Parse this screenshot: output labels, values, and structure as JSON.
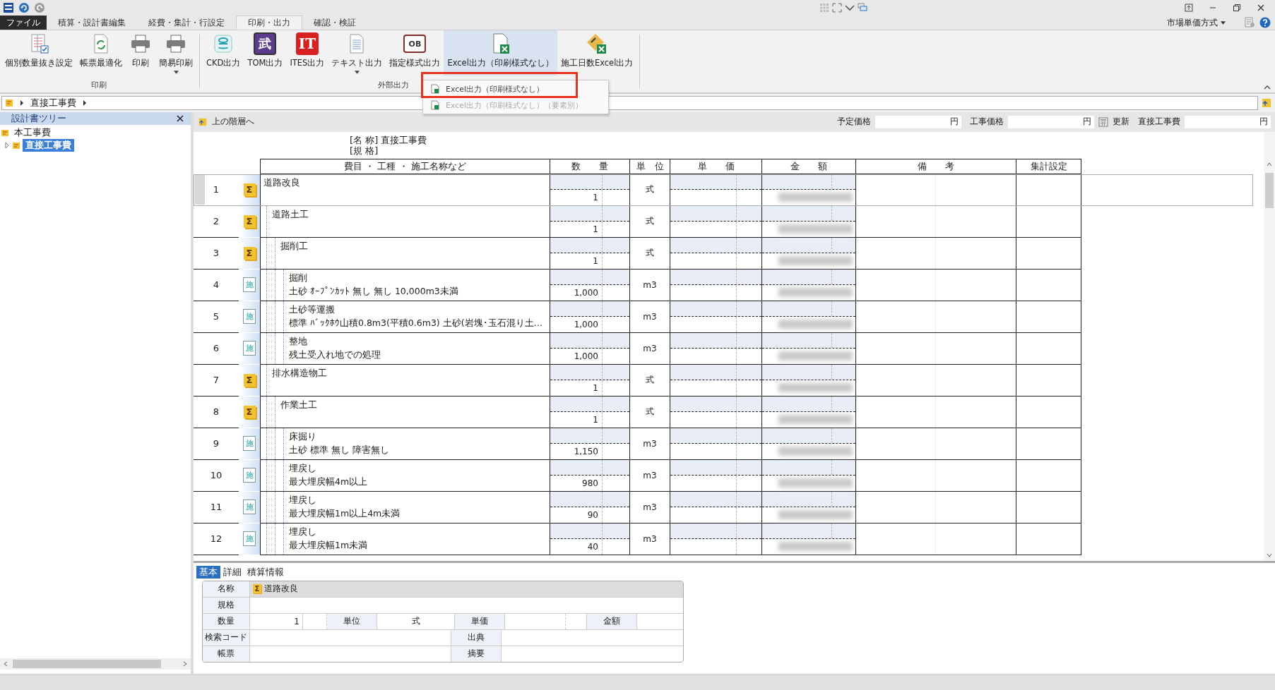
{
  "ribbon_tabs": [
    {
      "label": "ファイル",
      "kind": "file",
      "selected": false
    },
    {
      "label": "積算・設計書編集",
      "kind": "tab",
      "selected": false
    },
    {
      "label": "経費・集計・行設定",
      "kind": "tab",
      "selected": false
    },
    {
      "label": "印刷・出力",
      "kind": "tab",
      "selected": true
    },
    {
      "label": "確認・検証",
      "kind": "tab",
      "selected": false
    }
  ],
  "mode_menu": {
    "label": "市場単価方式"
  },
  "ribbon_groups": [
    {
      "label": "印刷",
      "buttons": [
        {
          "label": "個別数量抜き設定",
          "kind": "sheet-check",
          "pressed": false,
          "has_menu": false
        },
        {
          "label": "帳票最適化",
          "kind": "refresh-doc",
          "pressed": false,
          "has_menu": false
        },
        {
          "label": "印刷",
          "kind": "printer",
          "pressed": false,
          "has_menu": false
        },
        {
          "label": "簡易印刷",
          "kind": "printer",
          "pressed": false,
          "has_menu": true
        }
      ]
    },
    {
      "label": "外部出力",
      "buttons": [
        {
          "label": "CKD出力",
          "kind": "ckd",
          "pressed": false,
          "has_menu": false
        },
        {
          "label": "TOM出力",
          "kind": "tom",
          "icon_text": "武",
          "pressed": false,
          "has_menu": false
        },
        {
          "label": "ITES出力",
          "kind": "ites",
          "icon_text": "IT",
          "pressed": false,
          "has_menu": false
        },
        {
          "label": "テキスト出力",
          "kind": "text-doc",
          "pressed": false,
          "has_menu": true
        },
        {
          "label": "指定様式出力",
          "kind": "book",
          "icon_text": "OB",
          "pressed": false,
          "has_menu": false
        },
        {
          "label": "Excel出力（印刷様式なし）",
          "kind": "excel",
          "pressed": true,
          "has_menu": false
        },
        {
          "label": "施工日数Excel出力",
          "kind": "excel-tools",
          "pressed": false,
          "has_menu": false
        }
      ]
    }
  ],
  "dropdown_menu": {
    "items": [
      {
        "label": "Excel出力（印刷様式なし）",
        "disabled": false,
        "marked": true
      },
      {
        "label": "Excel出力（印刷様式なし）（要素別）",
        "disabled": true,
        "marked": false
      }
    ]
  },
  "breadcrumb": [
    "直接工事費"
  ],
  "tree_panel": {
    "title": "設計書ツリー",
    "items": [
      {
        "label": "本工事費",
        "selected": false,
        "children": [
          {
            "label": "直接工事費",
            "selected": true,
            "expanded": false
          }
        ]
      }
    ]
  },
  "toolbar": {
    "up_button": "上の階層へ",
    "items": [
      {
        "kind": "field",
        "label": "予定価格",
        "unit": "円"
      },
      {
        "kind": "field",
        "label": "工事価格",
        "unit": "円"
      },
      {
        "kind": "button",
        "label": "更新"
      },
      {
        "kind": "field",
        "label": "直接工事費",
        "unit": "円"
      }
    ]
  },
  "sheet": {
    "name_label": "[名 称]",
    "name_value": "直接工事費",
    "spec_label": "[規 格]",
    "columns": [
      "費目 ・ 工種 ・ 施工名称など",
      "数　　量",
      "単　位",
      "単　　価",
      "金　　額",
      "備　　考",
      "集計設定"
    ],
    "rows": [
      {
        "no": "1",
        "kind": "sum",
        "badge": "Σ",
        "name": "道路改良",
        "qty": "1",
        "unit": "式",
        "selected": true,
        "children": [
          {
            "no": "2",
            "kind": "sum",
            "badge": "Σ",
            "name": "道路土工",
            "qty": "1",
            "unit": "式",
            "selected": false,
            "children": [
              {
                "no": "3",
                "kind": "sum",
                "badge": "Σ",
                "name": "掘削工",
                "qty": "1",
                "unit": "式",
                "selected": false,
                "children": [
                  {
                    "no": "4",
                    "kind": "work",
                    "badge": "施",
                    "name": "掘削",
                    "spec": "土砂 ｵｰﾌﾟﾝｶｯﾄ 無し 無し 10,000m3未満",
                    "qty": "1,000",
                    "unit": "m3",
                    "selected": false
                  },
                  {
                    "no": "5",
                    "kind": "work",
                    "badge": "施",
                    "name": "土砂等運搬",
                    "spec": "標準 ﾊﾞｯｸﾎｳ山積0.8m3(平積0.6m3) 土砂(岩塊･玉石混り土…",
                    "qty": "1,000",
                    "unit": "m3",
                    "selected": false
                  },
                  {
                    "no": "6",
                    "kind": "work",
                    "badge": "施",
                    "name": "整地",
                    "spec": "残土受入れ地での処理",
                    "qty": "1,000",
                    "unit": "m3",
                    "selected": false
                  }
                ]
              }
            ]
          },
          {
            "no": "7",
            "kind": "sum",
            "badge": "Σ",
            "name": "排水構造物工",
            "qty": "1",
            "unit": "式",
            "selected": false,
            "children": [
              {
                "no": "8",
                "kind": "sum",
                "badge": "Σ",
                "name": "作業土工",
                "qty": "1",
                "unit": "式",
                "selected": false,
                "children": [
                  {
                    "no": "9",
                    "kind": "work",
                    "badge": "施",
                    "name": "床掘り",
                    "spec": "土砂 標準 無し 障害無し",
                    "qty": "1,150",
                    "unit": "m3",
                    "selected": false
                  },
                  {
                    "no": "10",
                    "kind": "work",
                    "badge": "施",
                    "name": "埋戻し",
                    "spec": "最大埋戻幅4m以上",
                    "qty": "980",
                    "unit": "m3",
                    "selected": false
                  },
                  {
                    "no": "11",
                    "kind": "work",
                    "badge": "施",
                    "name": "埋戻し",
                    "spec": "最大埋戻幅1m以上4m未満",
                    "qty": "90",
                    "unit": "m3",
                    "selected": false
                  },
                  {
                    "no": "12",
                    "kind": "work",
                    "badge": "施",
                    "name": "埋戻し",
                    "spec": "最大埋戻幅1m未満",
                    "qty": "40",
                    "unit": "m3",
                    "selected": false
                  }
                ]
              }
            ]
          }
        ]
      }
    ]
  },
  "detail_panel": {
    "tabs": [
      {
        "label": "基本",
        "selected": true
      },
      {
        "label": "詳細",
        "selected": false
      },
      {
        "label": "積算情報",
        "selected": false
      }
    ],
    "name_label": "名称",
    "name_badge": "Σ",
    "name_value": "道路改良",
    "spec_label": "規格",
    "qty_label": "数量",
    "qty_value": "1",
    "unit_label": "単位",
    "unit_value": "式",
    "price_label": "単価",
    "amount_label": "金額",
    "code_label": "検索コード",
    "source_label": "出典",
    "form_label": "帳票",
    "summary_label": "摘要"
  }
}
